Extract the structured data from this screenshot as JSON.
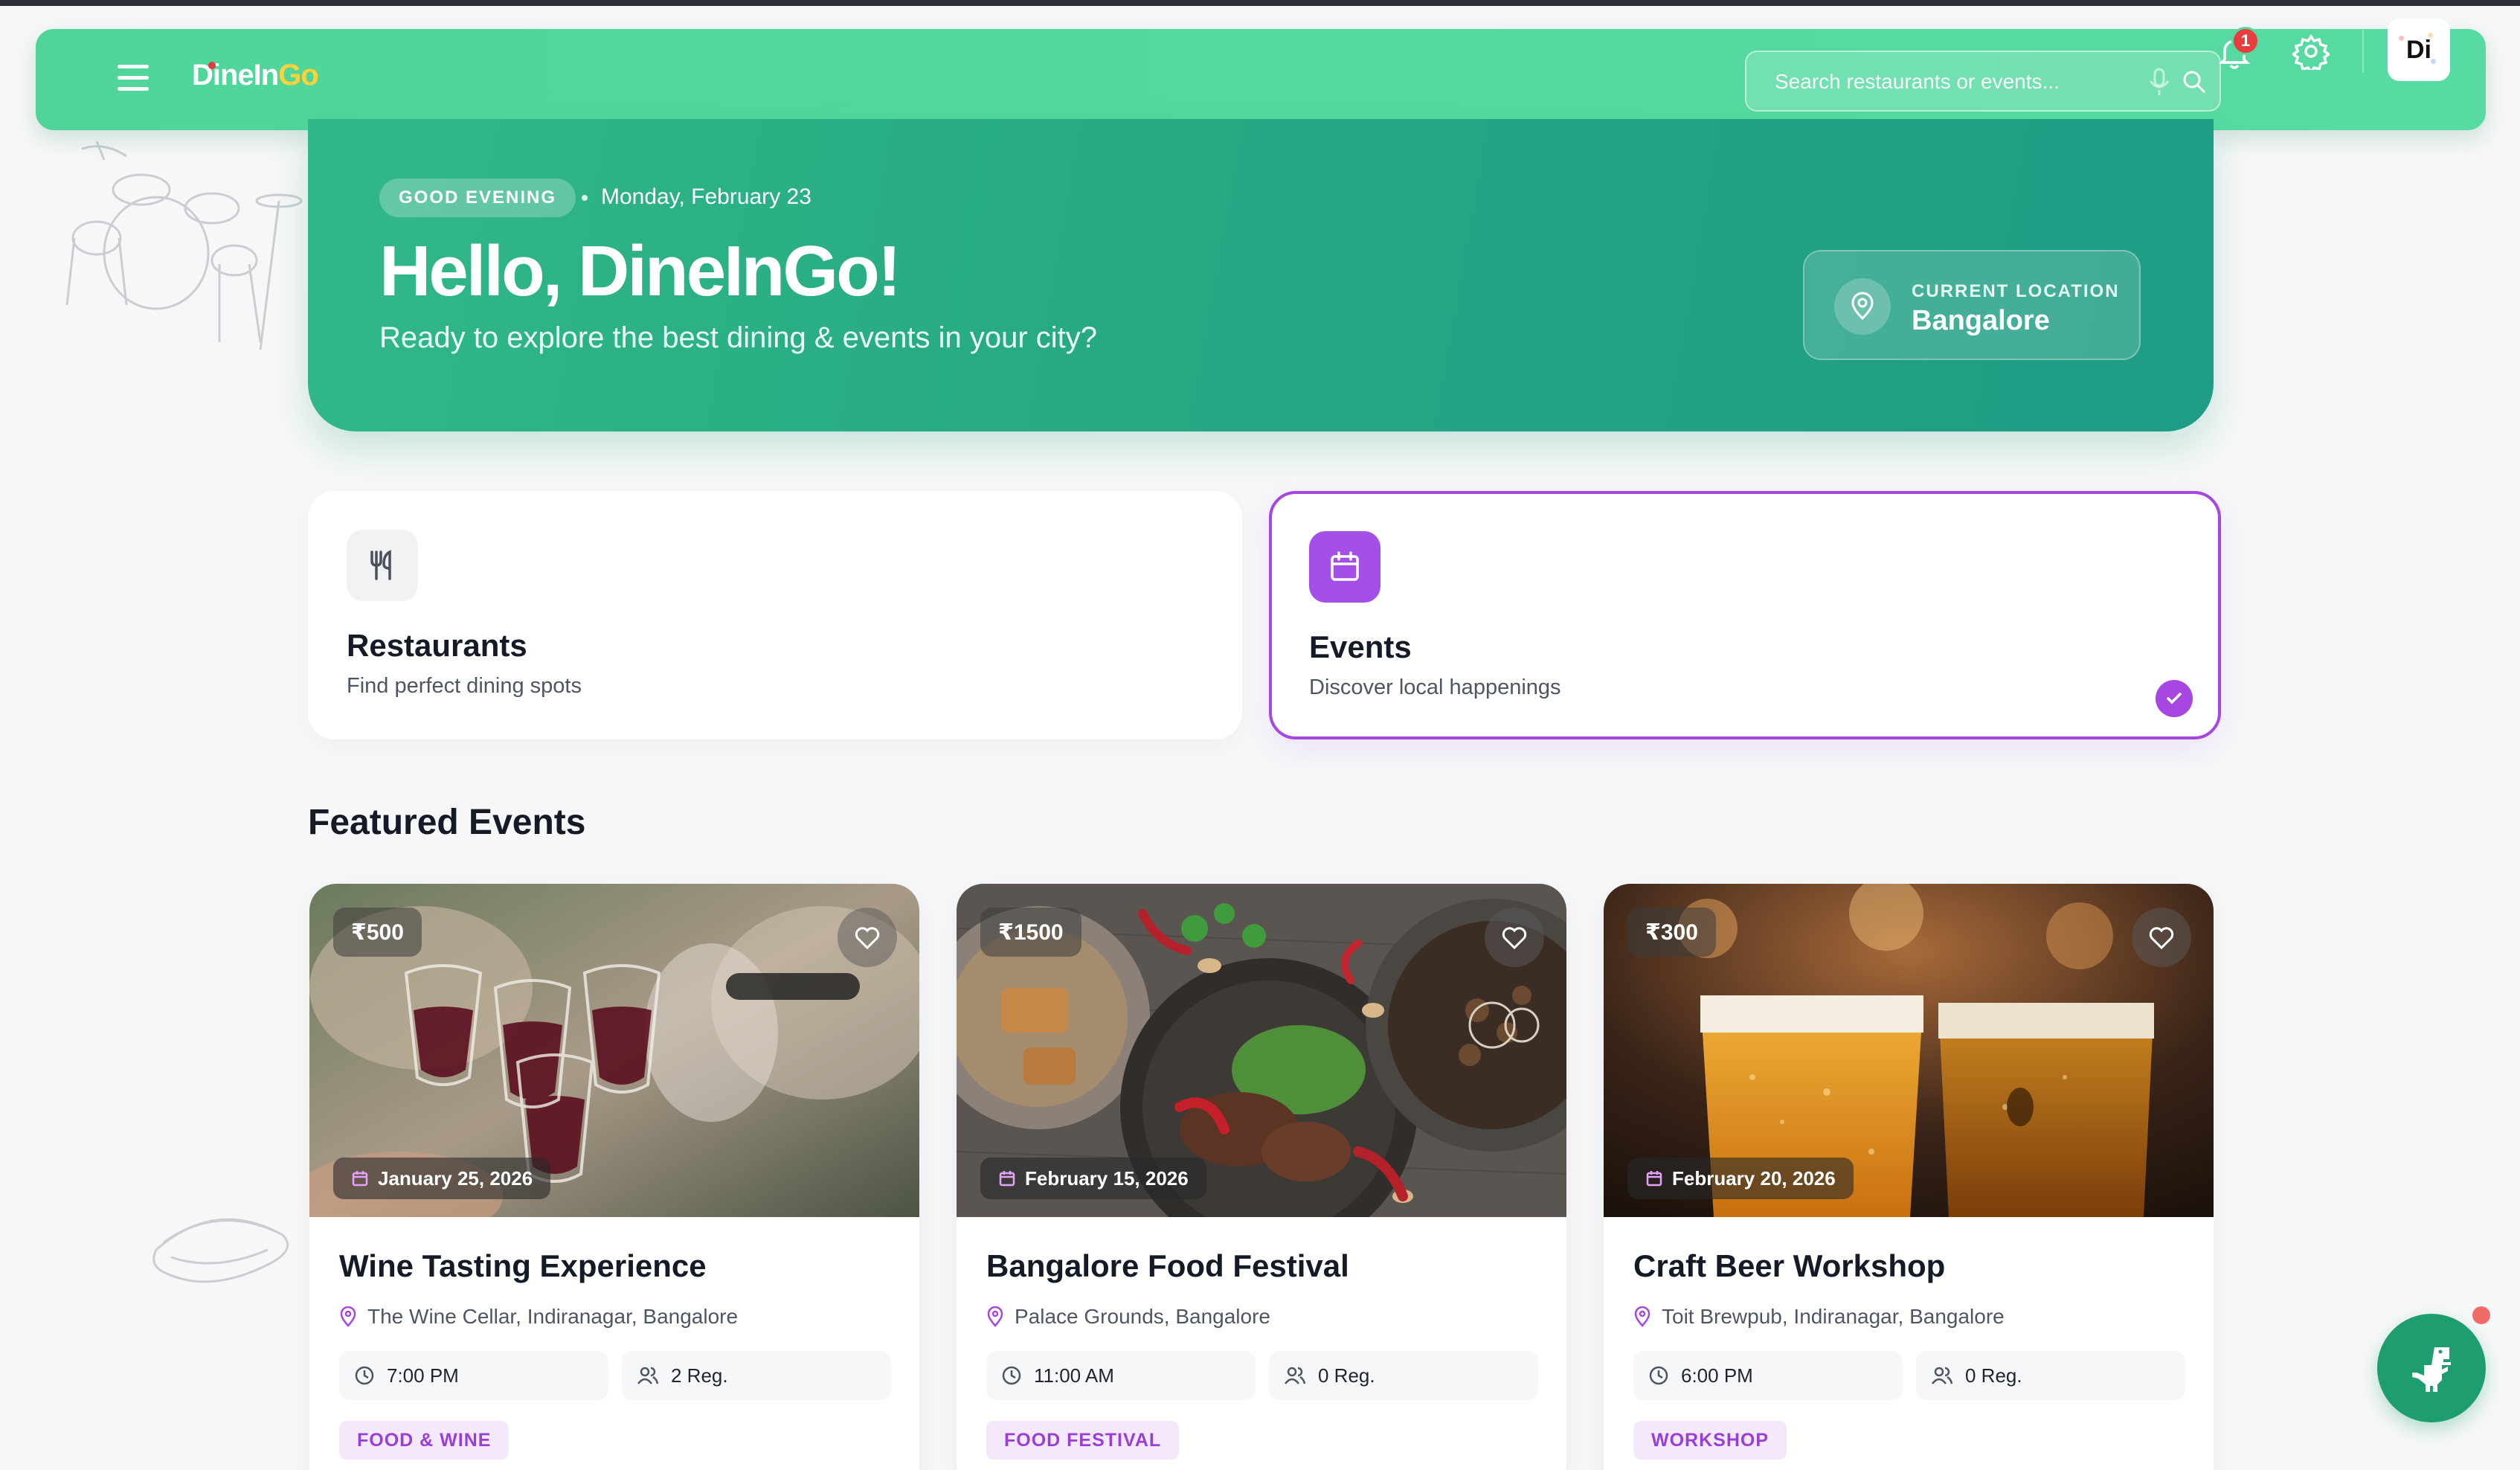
{
  "brand": {
    "logo_part1": "DineIn",
    "logo_part2": "Go"
  },
  "header": {
    "search_placeholder": "Search restaurants or events...",
    "notification_count": "1",
    "avatar_initials": "Di"
  },
  "hero": {
    "greeting_badge": "GOOD EVENING",
    "date": "Monday, February 23",
    "title": "Hello, DineInGo!",
    "subtitle": "Ready to explore the best dining & events in your city?",
    "location_label": "CURRENT LOCATION",
    "location_city": "Bangalore"
  },
  "categories": [
    {
      "title": "Restaurants",
      "description": "Find perfect dining spots",
      "selected": false
    },
    {
      "title": "Events",
      "description": "Discover local happenings",
      "selected": true
    }
  ],
  "featured": {
    "heading": "Featured Events",
    "events": [
      {
        "price": "₹500",
        "date": "January 25, 2026",
        "title": "Wine Tasting Experience",
        "location": "The Wine Cellar, Indiranagar, Bangalore",
        "time": "7:00 PM",
        "registrations": "2 Reg.",
        "tag": "FOOD & WINE"
      },
      {
        "price": "₹1500",
        "date": "February 15, 2026",
        "title": "Bangalore Food Festival",
        "location": "Palace Grounds, Bangalore",
        "time": "11:00 AM",
        "registrations": "0 Reg.",
        "tag": "FOOD FESTIVAL"
      },
      {
        "price": "₹300",
        "date": "February 20, 2026",
        "title": "Craft Beer Workshop",
        "location": "Toit Brewpub, Indiranagar, Bangalore",
        "time": "6:00 PM",
        "registrations": "0 Reg.",
        "tag": "WORKSHOP"
      }
    ]
  },
  "colors": {
    "primary_green": "#4fd59a",
    "hero_green": "#26a883",
    "accent_purple": "#a547e0",
    "badge_red": "#ea3d3d"
  }
}
